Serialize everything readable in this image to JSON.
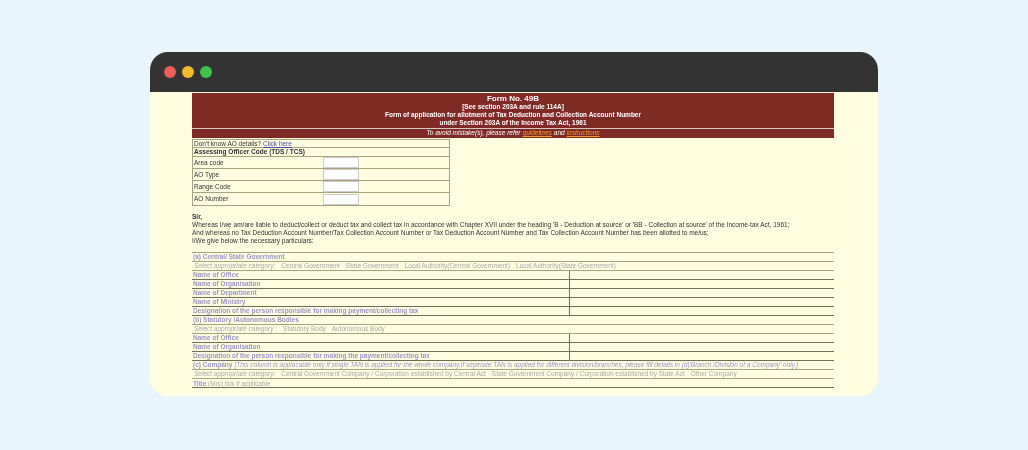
{
  "window": {
    "controls": [
      {
        "color": "#ec5f57"
      },
      {
        "color": "#f2b92f"
      },
      {
        "color": "#3ec449"
      }
    ]
  },
  "header": {
    "title": "Form No. 49B",
    "lines": [
      "[See section 203A and rule 114A]",
      "Form of application for allotment of Tax Deduction and Collection Account Number",
      "under Section 203A of the Income Tax Act, 1961"
    ],
    "note": "To avoid mistake(s), please refer",
    "link_1": "guidelines",
    "joiner": "and",
    "link_2": "instructions"
  },
  "ao": {
    "help_text": "Don't know AO details?",
    "help_link": "Click here",
    "heading": "Assessing Officer Code (TDS / TCS)",
    "fields": [
      {
        "label": "Area code"
      },
      {
        "label": "AO Type"
      },
      {
        "label": "Range Code"
      },
      {
        "label": "AO Number"
      }
    ]
  },
  "intro": {
    "salutation": "Sir,",
    "paragraphs": [
      "Whereas I/we am/are liable to deduct/collect or deduct tax and collect tax in accordance with Chapter XVII under the heading 'B - Deduction at source' or 'BB - Collection at source' of the Income-tax Act, 1961;",
      "And whereas no Tax Deduction Account Number/Tax Collection Account Number or Tax Deduction Account Number and Tax Collection Account Number has been allotted to me/us;",
      "I/We give below the necessary particulars:"
    ]
  },
  "sections": [
    {
      "title": "(a) Central/ State Government",
      "category_prompt": "Select appropriate category:",
      "options": [
        "Central Government",
        "State Government",
        "Local Authority(Central Government)",
        "Local Authority(State Government)"
      ],
      "rows": [
        {
          "kind": "field",
          "label": "Name of Office"
        },
        {
          "kind": "field",
          "label": "Name of Organisation"
        },
        {
          "kind": "field",
          "label": "Name of Department"
        },
        {
          "kind": "field",
          "label": "Name of Ministry"
        },
        {
          "kind": "field",
          "label": "Designation of the person responsible for making payment/collecting tax"
        }
      ]
    },
    {
      "title": "(b) Statutory /Autonomous Bodies",
      "category_prompt": "Select appropriate category :",
      "options": [
        "Statutory Body",
        "Autonomous Body"
      ],
      "rows": [
        {
          "kind": "field",
          "label": "Name of Office"
        },
        {
          "kind": "field",
          "label": "Name of Organisation"
        },
        {
          "kind": "field",
          "label": "Designation of the person responsible for making the payment/collecting tax"
        }
      ]
    },
    {
      "title": "(c) Company",
      "note": "[This column is applacable only if single TAN is applied for the whole company.If seperate TAN is applied for different division/branches, please fill details in (d)'Branch /Division of a Company' only.]",
      "category_prompt": "Select appropriate category:",
      "options": [
        "Central Government Company / Corporation established by Central Act",
        "State Government Company / Corporation established by State Act",
        "Other Company"
      ],
      "rows": [
        {
          "kind": "tick",
          "label": "**Title** (M/s) tick if applicable"
        }
      ]
    }
  ]
}
